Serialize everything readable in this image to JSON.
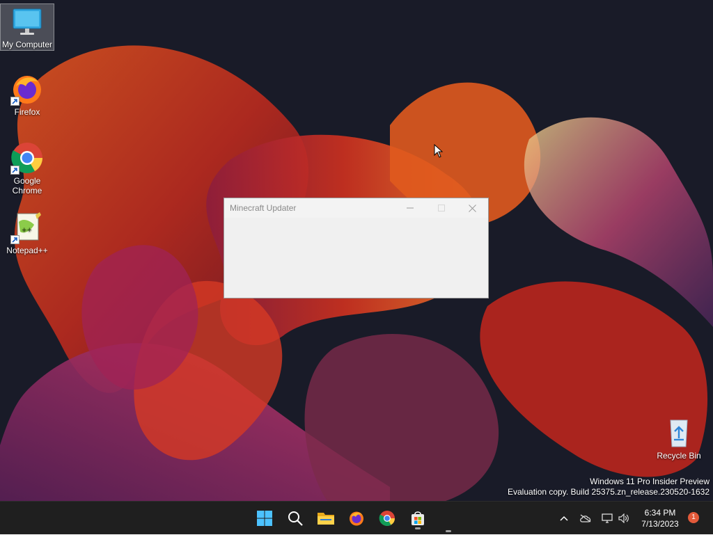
{
  "desktop": {
    "icons": [
      {
        "label": "My Computer",
        "icon": "computer-icon"
      },
      {
        "label": "Firefox",
        "icon": "firefox-icon"
      },
      {
        "label": "Google Chrome",
        "icon": "chrome-icon"
      },
      {
        "label": "Notepad++",
        "icon": "notepad-plus-plus-icon"
      },
      {
        "label": "Recycle Bin",
        "icon": "recycle-bin-icon"
      }
    ],
    "watermark": {
      "line1": "Windows 11 Pro Insider Preview",
      "line2": "Evaluation copy. Build 25375.zn_release.230520-1632"
    }
  },
  "window": {
    "title": "Minecraft Updater",
    "controls": [
      "minimize",
      "maximize",
      "close"
    ]
  },
  "taskbar": {
    "apps": [
      "start-icon",
      "search-icon",
      "file-explorer-icon",
      "firefox-icon",
      "chrome-icon",
      "microsoft-store-icon"
    ],
    "tray": [
      "chevron-up-icon",
      "onedrive-icon",
      "network-icon",
      "volume-icon"
    ],
    "time": "6:34 PM",
    "date": "7/13/2023",
    "notifications": "1"
  },
  "colors": {
    "taskbar_bg": "#1f1f1f",
    "window_bg": "#f0f0f0",
    "desktop_bg": "#191b28",
    "accent": "#0078d4"
  }
}
